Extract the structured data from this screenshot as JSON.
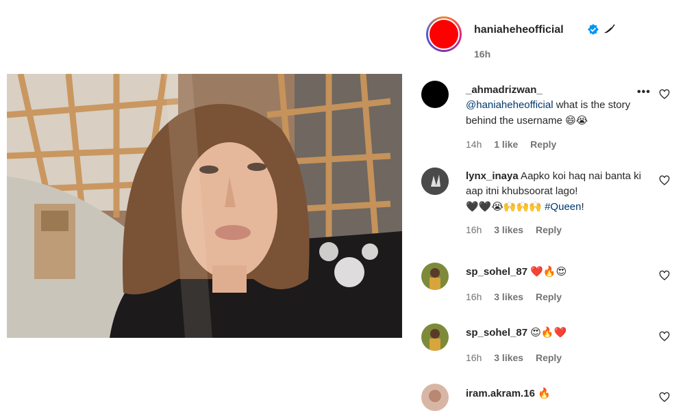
{
  "post": {
    "owner": {
      "username": "haniaheheofficial",
      "time": "16h",
      "badge": "pepper-icon"
    }
  },
  "comments": [
    {
      "username": "_ahmadrizwan_",
      "mention": "@haniaheheofficial",
      "text": " what is the story behind the username ",
      "emoji": "😄😭",
      "time": "14h",
      "likes": "1 like",
      "reply": "Reply",
      "has_more": "•••"
    },
    {
      "username": "lynx_inaya",
      "text": " Aapko koi haq nai banta ki aap itni khubsoorat lago!",
      "emoji": "🖤🖤😭🙌🙌🙌",
      "hashtag": "#Queen",
      "tail": "!",
      "time": "16h",
      "likes": "3 likes",
      "reply": "Reply"
    },
    {
      "username": "sp_sohel_87",
      "emoji": "❤️🔥😍",
      "time": "16h",
      "likes": "3 likes",
      "reply": "Reply"
    },
    {
      "username": "sp_sohel_87",
      "emoji": "😍🔥❤️",
      "time": "16h",
      "likes": "3 likes",
      "reply": "Reply"
    },
    {
      "username": "iram.akram.16",
      "emoji": "🔥"
    }
  ],
  "colors": {
    "text": "#262626",
    "muted": "#737373",
    "link": "#00376b",
    "verified": "#0095f6",
    "owner_avatar": "#ff0000"
  }
}
